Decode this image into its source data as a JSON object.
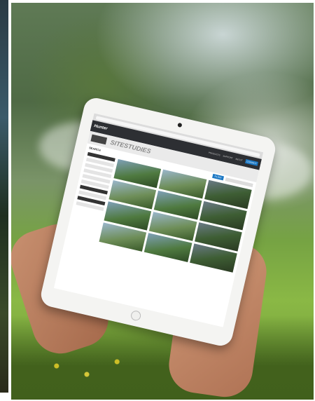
{
  "scene": {
    "subject": "hands-holding-tablet",
    "background": "garden-lawn-with-sprinklers"
  },
  "tablet_site": {
    "logo": "Hunter",
    "nav": [
      "PRODUCTS",
      "SUPPORT",
      "ABOUT"
    ],
    "nav_button": "CONTACT",
    "title_site": "SITE",
    "title_rest": "STUDIES",
    "crumb": "SEARCH",
    "filter_button": "FILTER"
  },
  "colors": {
    "accent": "#1c78c4",
    "header": "#2d2f33"
  }
}
